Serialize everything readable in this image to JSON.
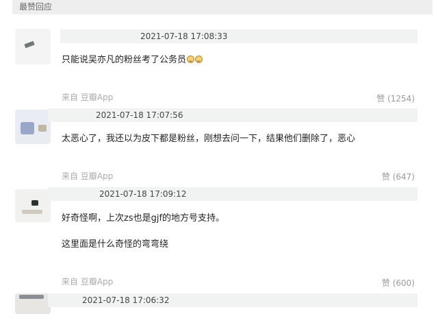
{
  "section": {
    "title": "最赞回应"
  },
  "comments": [
    {
      "timestamp": "2021-07-18 17:08:33",
      "lines": [
        "只能说吴亦凡的粉丝考了公务员"
      ],
      "emoji": [
        "laughing-emoji",
        "laughing-emoji"
      ],
      "source": "来自 豆瓣App",
      "likes": "赞 (1254)"
    },
    {
      "timestamp": "2021-07-18 17:07:56",
      "lines": [
        "太恶心了，我还以为皮下都是粉丝，刚想去问一下，结果他们删除了，恶心"
      ],
      "source": "来自 豆瓣App",
      "likes": "赞 (647)"
    },
    {
      "timestamp": "2021-07-18 17:09:12",
      "lines": [
        "好奇怪啊，上次zs也是gjf的地方号支持。",
        "这里面是什么奇怪的弯弯绕"
      ],
      "source": "来自 豆瓣App",
      "likes": "赞 (600)"
    },
    {
      "timestamp": "2021-07-18 17:06:32"
    }
  ]
}
